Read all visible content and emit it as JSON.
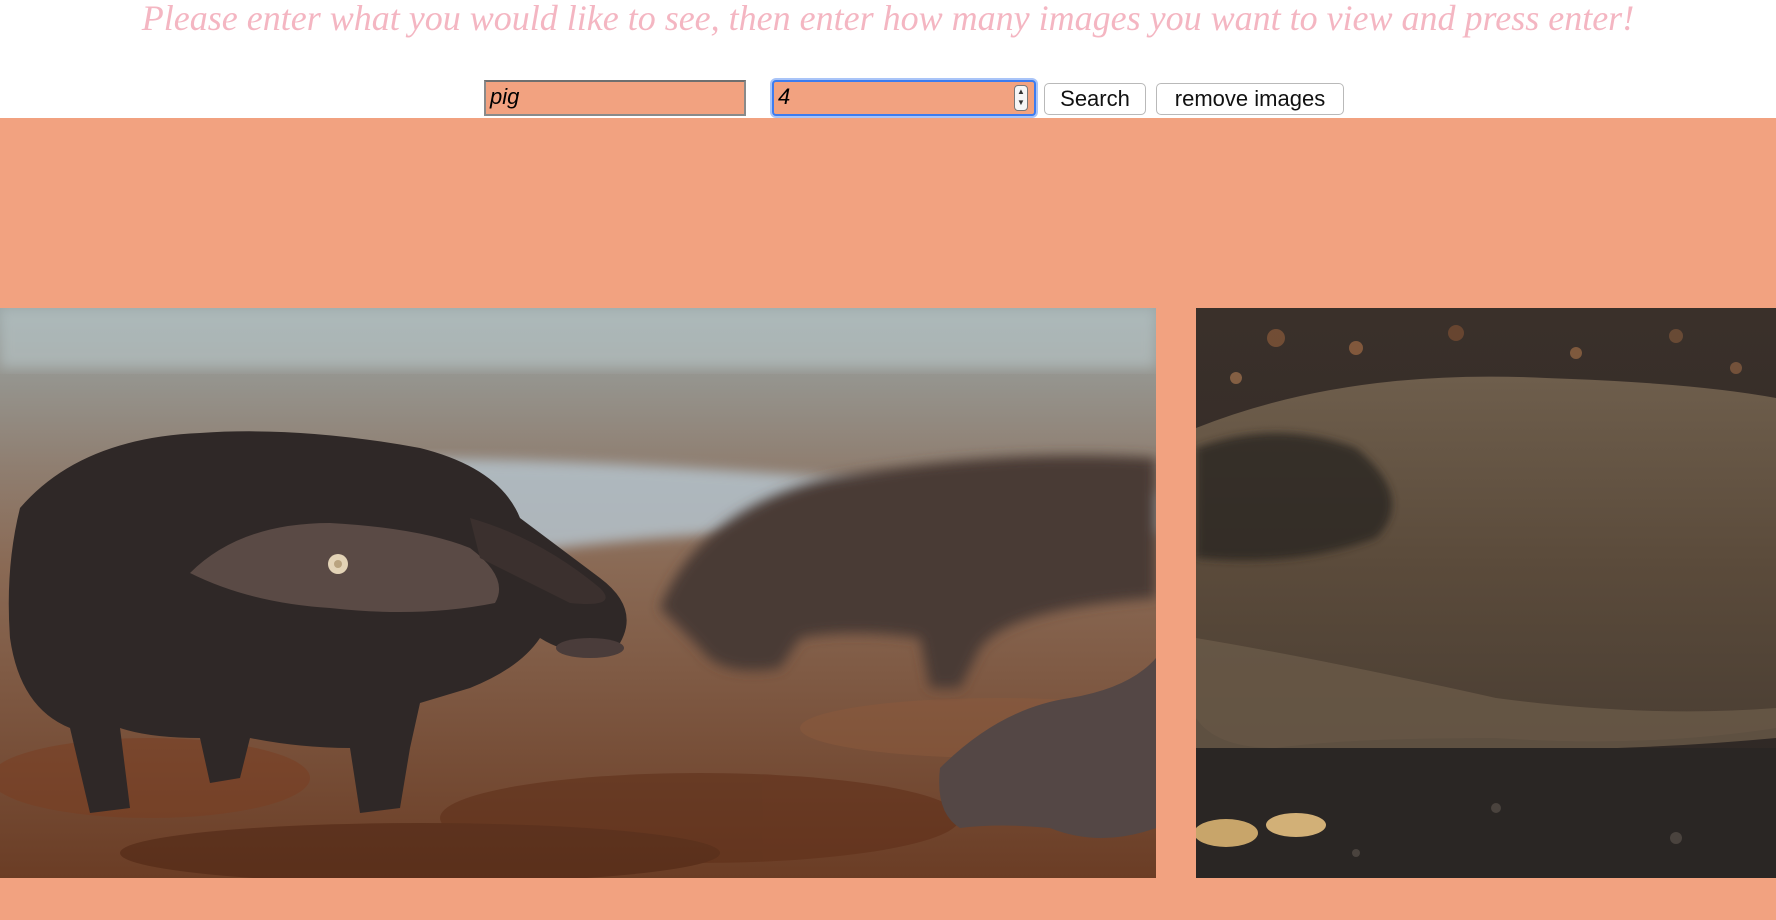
{
  "header": {
    "instructions": "Please enter what you would like to see, then enter how many images you want to view and press enter!"
  },
  "form": {
    "query_value": "pig",
    "count_value": "4",
    "search_label": "Search",
    "remove_label": "remove images"
  },
  "gallery": {
    "images": [
      {
        "subject": "black pigs foraging on leaf-covered ground"
      },
      {
        "subject": "wild boar close-up on dark soil"
      }
    ]
  },
  "colors": {
    "background_accent": "#f2a280",
    "headline": "#f4b6c2",
    "focus_ring": "#3d7cf0"
  }
}
